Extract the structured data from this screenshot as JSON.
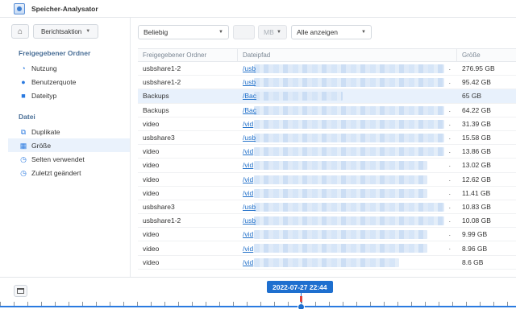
{
  "app": {
    "title": "Speicher-Analysator"
  },
  "sidebar": {
    "report_action": "Berichtsaktion",
    "sections": [
      {
        "title": "Freigegebener Ordner",
        "items": [
          {
            "label": "Nutzung",
            "icon": "pie-chart-icon"
          },
          {
            "label": "Benutzerquote",
            "icon": "user-icon"
          },
          {
            "label": "Dateityp",
            "icon": "file-icon"
          }
        ]
      },
      {
        "title": "Datei",
        "items": [
          {
            "label": "Duplikate",
            "icon": "duplicate-icon"
          },
          {
            "label": "Größe",
            "icon": "size-icon",
            "active": true
          },
          {
            "label": "Selten verwendet",
            "icon": "clock-icon"
          },
          {
            "label": "Zuletzt geändert",
            "icon": "clock-icon"
          }
        ]
      }
    ]
  },
  "filters": {
    "type": "Beliebig",
    "size_input": "",
    "unit": "MB",
    "show": "Alle anzeigen"
  },
  "table": {
    "headers": [
      "Freigegebener Ordner",
      "Dateipfad",
      "Größe"
    ],
    "rows": [
      {
        "folder": "usbshare1-2",
        "path": "/usb",
        "size": "276.95 GB"
      },
      {
        "folder": "usbshare1-2",
        "path": "/usb",
        "size": "95.42 GB"
      },
      {
        "folder": "Backups",
        "path": "/Bac",
        "size": "65 GB"
      },
      {
        "folder": "Backups",
        "path": "/Bac",
        "size": "64.22 GB"
      },
      {
        "folder": "video",
        "path": "/vid",
        "size": "31.39 GB"
      },
      {
        "folder": "usbshare3",
        "path": "/usb",
        "size": "15.58 GB"
      },
      {
        "folder": "video",
        "path": "/vid",
        "size": "13.86 GB"
      },
      {
        "folder": "video",
        "path": "/vid",
        "size": "13.02 GB"
      },
      {
        "folder": "video",
        "path": "/vid",
        "size": "12.62 GB"
      },
      {
        "folder": "video",
        "path": "/vid",
        "size": "11.41 GB"
      },
      {
        "folder": "usbshare3",
        "path": "/usb",
        "size": "10.83 GB"
      },
      {
        "folder": "usbshare1-2",
        "path": "/usb",
        "size": "10.08 GB"
      },
      {
        "folder": "video",
        "path": "/vid",
        "size": "9.99 GB"
      },
      {
        "folder": "video",
        "path": "/vid",
        "size": "8.96 GB"
      },
      {
        "folder": "video",
        "path": "/vid",
        "size": "8.6 GB"
      }
    ]
  },
  "timeline": {
    "selected_date": "2022-07-27 22:44"
  }
}
